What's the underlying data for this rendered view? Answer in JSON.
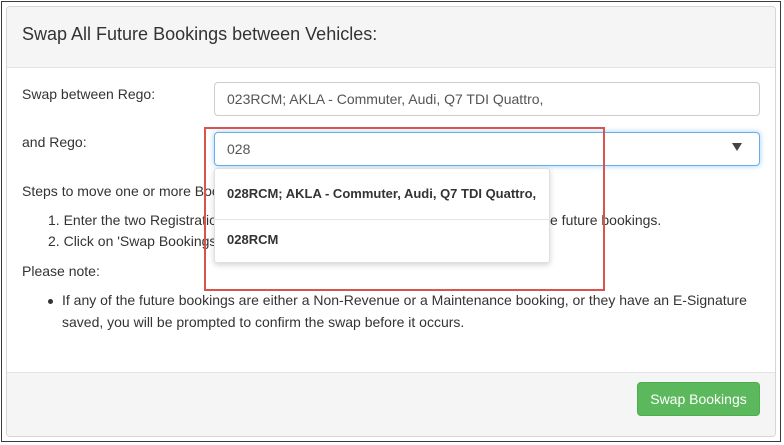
{
  "modal": {
    "title": "Swap All Future Bookings between Vehicles:"
  },
  "form": {
    "rego1_label": "Swap between Rego:",
    "rego1_value": "023RCM; AKLA - Commuter, Audi, Q7 TDI Quattro,",
    "rego2_label": "and Rego:",
    "rego2_value": "028"
  },
  "dropdown": {
    "options": [
      "028RCM; AKLA - Commuter, Audi, Q7 TDI Quattro,",
      "028RCM"
    ]
  },
  "steps": {
    "intro_visible": "Steps to move one or more Boo",
    "items": [
      {
        "left": "Enter the two Registratio",
        "right": "e future bookings."
      },
      {
        "left": "Click on 'Swap Bookings"
      }
    ]
  },
  "notes": {
    "heading": "Please note:",
    "line1": "If any of the future bookings are either a Non-Revenue or a Maintenance booking, or they have an E-Signature",
    "line2": "saved, you will be prompted to confirm the swap before it occurs."
  },
  "footer": {
    "swap_button": "Swap Bookings"
  },
  "colors": {
    "highlight_border": "#d9534f",
    "primary_button": "#5cb85c",
    "focus_border": "#66afe9"
  },
  "icons": {
    "select_caret": "chevron-down-icon"
  }
}
